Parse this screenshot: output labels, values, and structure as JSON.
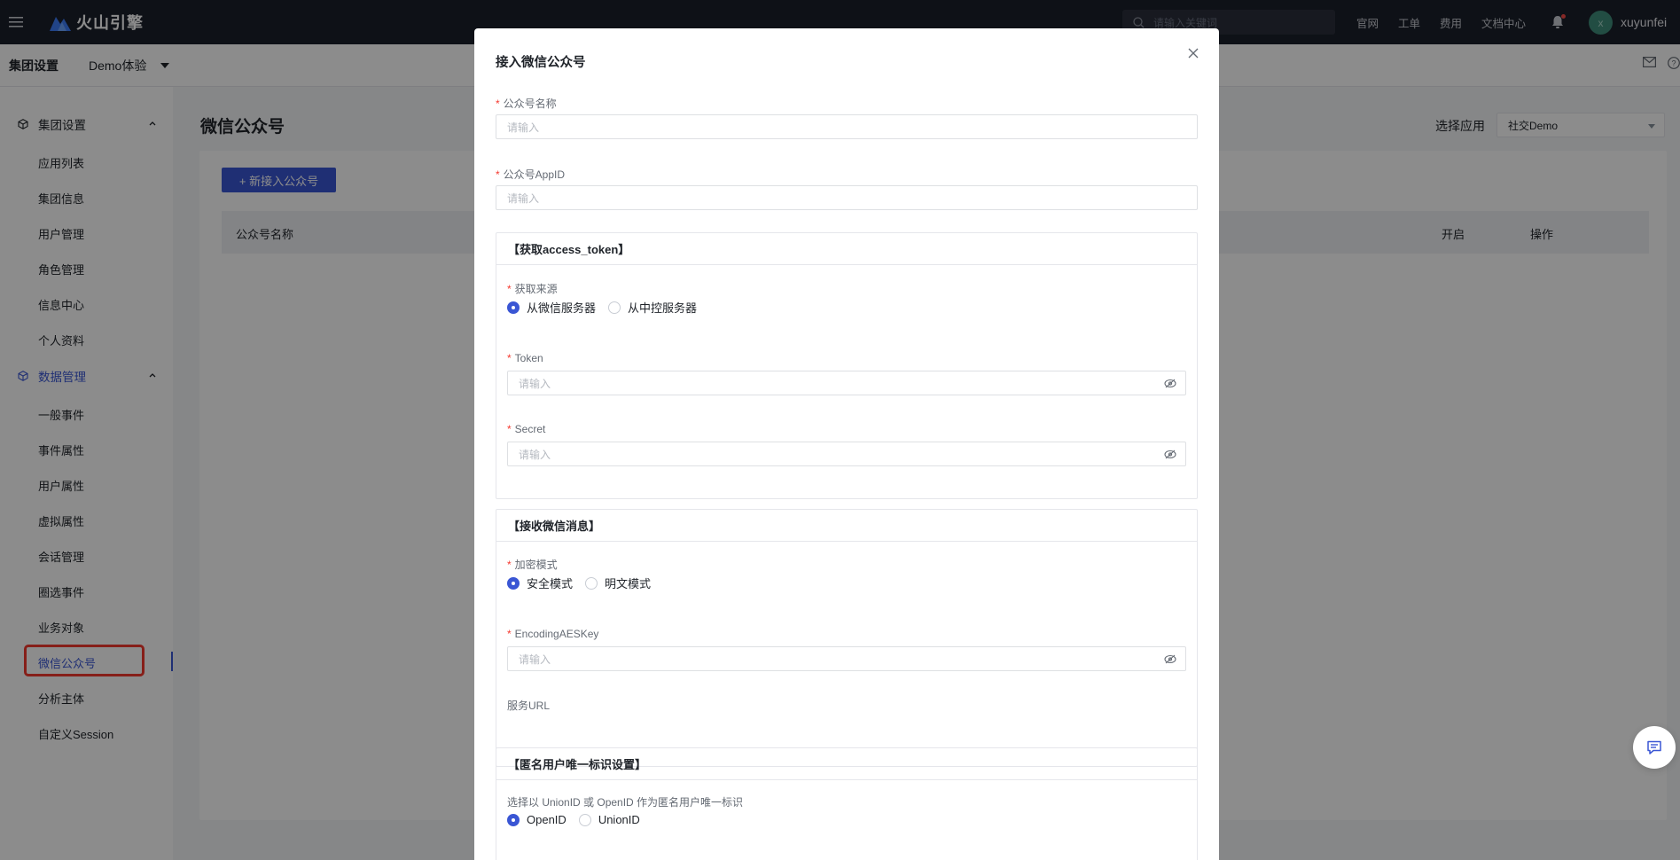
{
  "topbar": {
    "brand": "火山引擎",
    "search_placeholder": "请输入关键词",
    "links": [
      "官网",
      "工单",
      "费用",
      "文档中心"
    ],
    "avatar_letter": "x",
    "username": "xuyunfei"
  },
  "subbar": {
    "title": "集团设置",
    "project": "Demo体验"
  },
  "sidebar": {
    "group1": "集团设置",
    "group1_items": [
      "应用列表",
      "集团信息",
      "用户管理",
      "角色管理",
      "信息中心",
      "个人资料"
    ],
    "group2": "数据管理",
    "group2_items": [
      "一般事件",
      "事件属性",
      "用户属性",
      "虚拟属性",
      "会话管理",
      "圈选事件",
      "业务对象",
      "微信公众号",
      "分析主体",
      "自定义Session"
    ]
  },
  "main": {
    "title": "微信公众号",
    "app_select_label": "选择应用",
    "app_select_value": "社交Demo",
    "add_button": "+ 新接入公众号",
    "columns": [
      "公众号名称",
      "开启",
      "操作"
    ]
  },
  "modal": {
    "title": "接入微信公众号",
    "name_label": "公众号名称",
    "appid_label": "公众号AppID",
    "placeholder": "请输入",
    "section1": {
      "title": "【获取access_token】",
      "source_label": "获取来源",
      "source_options": [
        "从微信服务器",
        "从中控服务器"
      ],
      "token_label": "Token",
      "secret_label": "Secret"
    },
    "section2": {
      "title": "【接收微信消息】",
      "mode_label": "加密模式",
      "mode_options": [
        "安全模式",
        "明文模式"
      ],
      "aeskey_label": "EncodingAESKey",
      "url_label": "服务URL"
    },
    "section3": {
      "title": "【匿名用户唯一标识设置】",
      "hint": "选择以 UnionID 或 OpenID 作为匿名用户唯一标识",
      "options": [
        "OpenID",
        "UnionID"
      ]
    }
  },
  "colors": {
    "primary": "#3a56d4",
    "highlight": "#f5392f",
    "topbar": "#1b1f2a"
  }
}
